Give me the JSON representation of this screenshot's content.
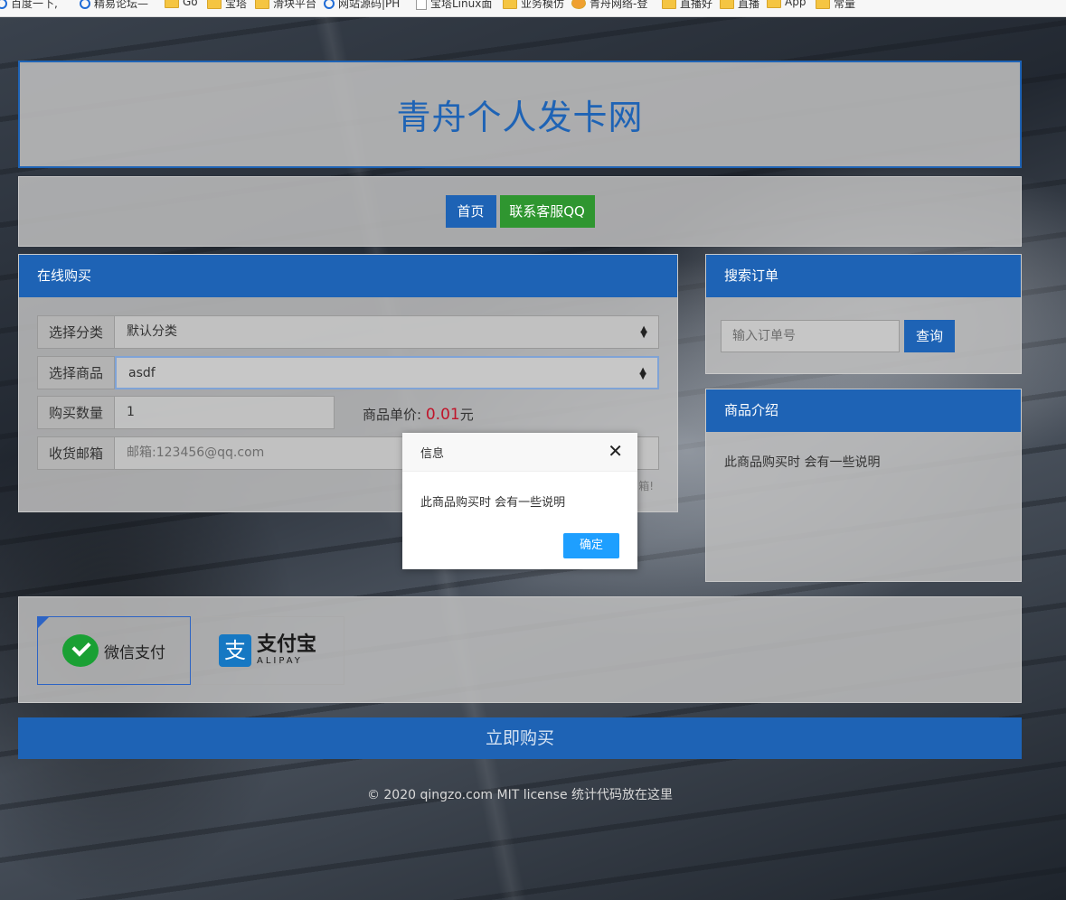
{
  "bookmarks": [
    {
      "label": "百度一下,",
      "icon": "bookmark-icon"
    },
    {
      "label": "精易论坛—",
      "icon": "globe-icon"
    },
    {
      "label": "Go",
      "icon": "folder-icon"
    },
    {
      "label": "宝塔",
      "icon": "folder-icon"
    },
    {
      "label": "滑块平台",
      "icon": "folder-icon"
    },
    {
      "label": "网站源码|PH",
      "icon": "globe-icon"
    },
    {
      "label": "宝塔Linux面",
      "icon": "page-icon"
    },
    {
      "label": "业务模仿",
      "icon": "folder-icon"
    },
    {
      "label": "青舟网络-登",
      "icon": "bookmark-icon"
    },
    {
      "label": "直播好",
      "icon": "folder-icon"
    },
    {
      "label": "直播",
      "icon": "folder-icon"
    },
    {
      "label": "App",
      "icon": "folder-icon"
    },
    {
      "label": "常量",
      "icon": "folder-icon"
    }
  ],
  "header": {
    "title": "青舟个人发卡网"
  },
  "nav": {
    "home": "首页",
    "contact": "联系客服QQ"
  },
  "buy": {
    "title": "在线购买",
    "category_label": "选择分类",
    "category_value": "默认分类",
    "product_label": "选择商品",
    "product_value": "asdf",
    "quantity_label": "购买数量",
    "quantity_value": "1",
    "price_label": "商品单价:",
    "price_value": "0.01",
    "price_unit": "元",
    "email_label": "收货邮箱",
    "email_placeholder": "邮箱:123456@qq.com",
    "hint_tail": "箱!"
  },
  "search": {
    "title": "搜索订单",
    "placeholder": "输入订单号",
    "button": "查询"
  },
  "intro": {
    "title": "商品介绍",
    "text": "此商品购买时 会有一些说明"
  },
  "payment": {
    "wechat": "微信支付",
    "alipay_cn": "支付宝",
    "alipay_en": "ALIPAY",
    "alipay_glyph": "支",
    "selected": "wechat"
  },
  "buy_now": "立即购买",
  "footer": "© 2020 qingzo.com MIT license 统计代码放在这里",
  "dialog": {
    "title": "信息",
    "close": "✕",
    "message": "此商品购买时 会有一些说明",
    "ok": "确定"
  },
  "colors": {
    "primary": "#1e63b5",
    "qq_button": "#2f9630",
    "price": "#c0142a",
    "dialog_ok": "#1e9fff"
  }
}
